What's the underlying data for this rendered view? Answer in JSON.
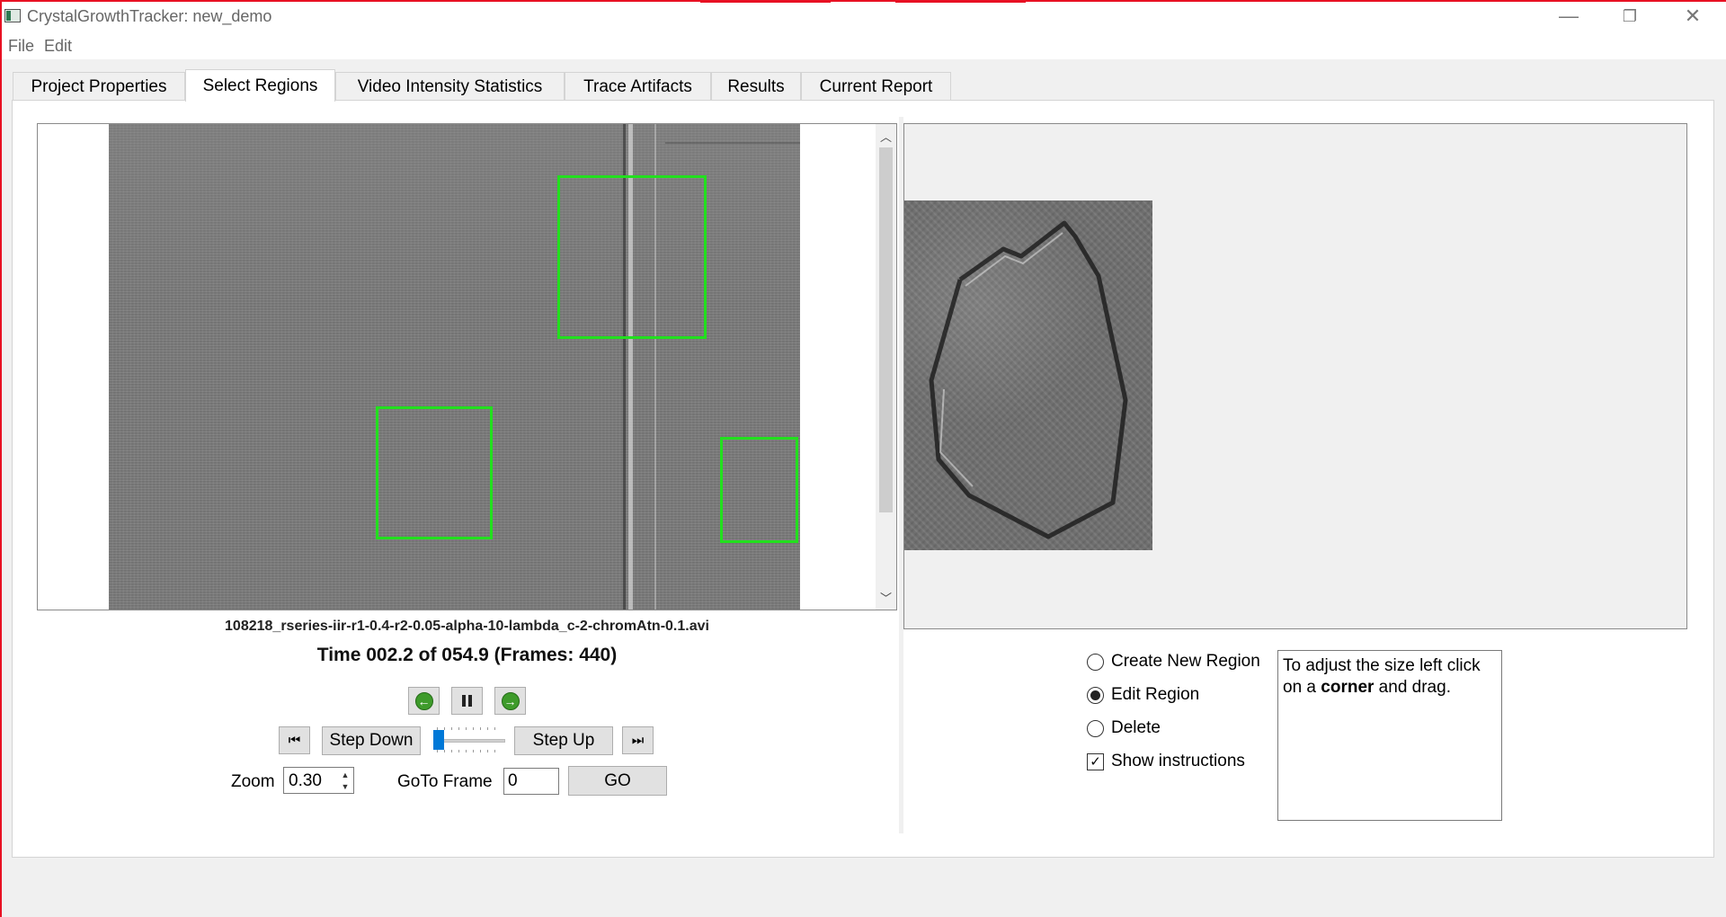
{
  "window": {
    "title": "CrystalGrowthTracker: new_demo",
    "minimize_glyph": "—",
    "restore_glyph": "❐",
    "close_glyph": "✕"
  },
  "menu": {
    "file": "File",
    "edit": "Edit"
  },
  "tabs": [
    {
      "label": "Project Properties",
      "active": false
    },
    {
      "label": "Select Regions",
      "active": true
    },
    {
      "label": "Video Intensity Statistics",
      "active": false
    },
    {
      "label": "Trace Artifacts",
      "active": false
    },
    {
      "label": "Results",
      "active": false
    },
    {
      "label": "Current Report",
      "active": false
    }
  ],
  "video": {
    "filename": "108218_rseries-iir-r1-0.4-r2-0.05-alpha-10-lambda_c-2-chromAtn-0.1.avi",
    "time_text": "Time 002.2 of 054.9 (Frames: 440)",
    "region_count": 3,
    "slider_position": 0.0,
    "region_color": "#22e01e"
  },
  "controls": {
    "back_icon": "arrow-left-icon",
    "pause_icon": "pause-icon",
    "forward_icon": "arrow-right-icon",
    "first_frame_icon": "skip-first-icon",
    "last_frame_icon": "skip-last-icon",
    "step_down_label": "Step Down",
    "step_up_label": "Step Up",
    "zoom_label": "Zoom",
    "zoom_value": "0.30",
    "goto_label": "GoTo Frame",
    "goto_value": "0",
    "go_label": "GO"
  },
  "region_mode": {
    "options": [
      {
        "label": "Create New Region",
        "checked": false
      },
      {
        "label": "Edit Region",
        "checked": true
      },
      {
        "label": "Delete",
        "checked": false
      }
    ],
    "show_instructions_label": "Show instructions",
    "show_instructions_checked": true,
    "instructions_before": "To adjust the size left click on a ",
    "instructions_bold": "corner",
    "instructions_after": " and drag."
  }
}
